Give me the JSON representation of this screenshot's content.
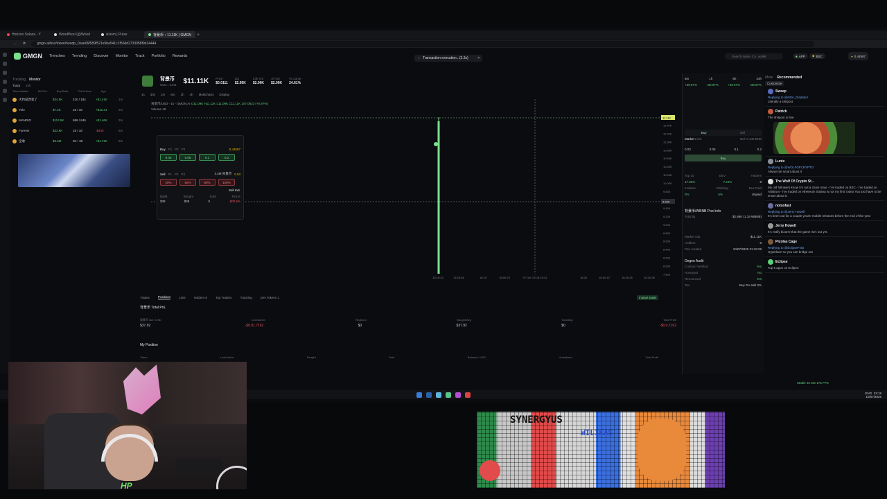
{
  "browser": {
    "tabs": [
      {
        "label": "Horizon Solana - Y"
      },
      {
        "label": "WoodPixel (@Wood"
      },
      {
        "label": "Axiom | Pulse"
      },
      {
        "label": "背景币 ↑ 11.11K | GMGN"
      }
    ],
    "url": "gmgn.ai/bsc/token/hoodp_0xae06f589f521e5ba541c1f55dd2733058f9d14444"
  },
  "nav": {
    "brand": "GMGN",
    "items": [
      "Trenches",
      "Trending",
      "Discover",
      "Monitor",
      "Track",
      "Portfolio",
      "Rewards"
    ],
    "toast": "Transaction execution...(3.3s)",
    "search_placeholder": "Search name, CA, wallet",
    "app_label": "APP",
    "chain": "BSC",
    "balance": "0.44597"
  },
  "monitor": {
    "title": "Monitor",
    "tab": "Track",
    "period": "24h",
    "columns": [
      "Token/Wallet",
      "MC/Vol",
      "Buy/Sells",
      "PNL/Inflow",
      "Age"
    ],
    "rows": [
      {
        "name": "大约就改变了",
        "mc": "$34.8K",
        "buys": "310 / 184",
        "pnl": "+$1.41K",
        "age": "1m"
      },
      {
        "name": "Yolo",
        "mc": "$7.2K",
        "buys": "18 / 18",
        "pnl": "+$42.41",
        "age": "2m"
      },
      {
        "name": "MANDIO",
        "mc": "$113.5K",
        "buys": "686 / 649",
        "pnl": "+$1.46K",
        "age": "3m"
      },
      {
        "name": "Forever",
        "mc": "$33.8K",
        "buys": "18 / 18",
        "pnl": "-$430",
        "age": "5m"
      },
      {
        "name": "全收",
        "mc": "$3.6M",
        "buys": "3K / 3K",
        "pnl": "+$1.72K",
        "age": "8m"
      }
    ]
  },
  "token": {
    "name": "背景币",
    "address": "0xae...4444",
    "price": "$11.11K",
    "stats": [
      {
        "label": "Price",
        "value": "$0.0111"
      },
      {
        "label": "Liq",
        "value": "$2.95K"
      },
      {
        "label": "24h Vol",
        "value": "$2.09K"
      },
      {
        "label": "1h Vol",
        "value": "$2.09K"
      },
      {
        "label": "% Curve",
        "value": "24.61%"
      }
    ],
    "chart_title": "背景币/USD - 1s - GMGN.AI",
    "ohlc": "O11.09K H11.11K L11.09K C11.11K 107.0623 (+0.97%)",
    "volume_label": "Volume",
    "volume_value": "18"
  },
  "chart_data": {
    "type": "candlestick",
    "x_ticks": [
      "15:15:23",
      "15:15:46",
      "15:19",
      "16:00:23",
      "07 Oct '25  16:15:31",
      "16:20",
      "16:20:13",
      "16:20:26",
      "16:20:39"
    ],
    "y_ticks": [
      "11.60K",
      "11.40K",
      "11.20K",
      "11.00K",
      "10.80K",
      "10.60K",
      "10.40K",
      "10.20K",
      "10.00K",
      "9.80K",
      "9.60K",
      "9.40K",
      "9.20K",
      "9.00K",
      "8.80K",
      "8.60K",
      "8.40K",
      "8.20K",
      "8.00K",
      "7.80K"
    ],
    "last_price": "11.11K",
    "crosshair_price": "9.23K",
    "ylim": [
      7700,
      11700
    ]
  },
  "quick": {
    "buy_label": "Buy",
    "sell_label": "Sell",
    "presets": [
      "P1",
      "P2",
      "P3"
    ],
    "balance": "0.44597",
    "buy_amounts": [
      "0.03",
      "0.05",
      "0.1",
      "0.2"
    ],
    "sell_amounts": [
      "20%",
      "50%",
      "80%",
      "100%"
    ],
    "sell_holding": "3.4M 背景币",
    "sell_value": "0.03",
    "sell_init": "Sell Initi.",
    "foot_labels": [
      "Bal/$",
      "Bought",
      "Sold",
      "PnL%"
    ],
    "foot_values": [
      "$38",
      "$38",
      "0",
      "-$00.6%"
    ]
  },
  "bottom": {
    "tabs": [
      "Trades",
      "Positions",
      "Limit",
      "Holders 8",
      "Top Traders",
      "Tracking",
      "Dev Tokens 1"
    ],
    "active_tab": "Positions",
    "instant_trade": "Instant trade",
    "pnl_title": "背景币 Total PnL",
    "columns": [
      "背景币 Bal / USD",
      "Unrealized",
      "Realized",
      "Bought/Avg",
      "Sold/Avg",
      "Total Profit"
    ],
    "values": [
      "$37.92",
      "-$0.01.7162",
      "$0",
      "$37.92",
      "$0",
      "-$0.0,7162"
    ],
    "my_position": "My Position",
    "pos_columns": [
      "Token",
      "Last Active",
      "Bought",
      "Sold",
      "Balance / USD",
      "Unrealized",
      "Total Profit"
    ]
  },
  "trade": {
    "tabs": [
      "5m",
      "1h",
      "6h",
      "24h"
    ],
    "changes": [
      "+39.97%",
      "+39.97%",
      "+39.97%",
      "+39.97%"
    ],
    "buy_label": "Buy",
    "sell_label": "Sell",
    "market_label": "Market",
    "limit_label": "Limit",
    "bal_label": "Bal: 0.446 BNB",
    "amounts": [
      "0.03",
      "0.05",
      "0.1",
      "0.2"
    ],
    "stats": [
      {
        "label": "Top 10",
        "value": "17.36%"
      },
      {
        "label": "DEV",
        "value": "7.24%"
      },
      {
        "label": "Holders",
        "value": "8"
      },
      {
        "label": "Insiders",
        "value": "0%"
      },
      {
        "label": "Phishing",
        "value": "6%"
      },
      {
        "label": "Dex Paid",
        "value": "Unpaid"
      }
    ],
    "pool_title": "背景币/WBNB Pool info",
    "pool_rows": [
      {
        "label": "Total liq",
        "value": "$2.95K (1.19 WBNB)"
      },
      {
        "label": "Market cap",
        "value": "$11.11K"
      },
      {
        "label": "Holders",
        "value": "8"
      },
      {
        "label": "Pair created",
        "value": "10/07/2025 21:18:29"
      }
    ],
    "audit_title": "Degen Audit",
    "audit_rows": [
      {
        "label": "Contract Verified",
        "value": "Yes"
      },
      {
        "label": "Honeypot",
        "value": "No"
      },
      {
        "label": "Renounced",
        "value": "Yes"
      },
      {
        "label": "Tax",
        "value": "Buy 0% Sell 0%"
      }
    ]
  },
  "feed": {
    "title": "Recommended",
    "customize": "Customize",
    "posts": [
      {
        "name": "Sweep",
        "reply": "Replying to @KEK_Gladiator",
        "text": "Literally a shitpost"
      },
      {
        "name": "Patrick",
        "reply": "",
        "text": "The shitpost is fine"
      },
      {
        "name": "Lunix",
        "reply": "Replying to @WOLFOFCRYPTO",
        "text": "Always be smart about it"
      },
      {
        "name": "The Wolf Of Crypto St...",
        "reply": "",
        "text": "My old followers know I'm not a chain maxi - I've traded on BSC - I've traded on Arbitrum - I've traded on ethereum Solana is not my first rodeo You just have to be smart about it."
      },
      {
        "name": "notsofast",
        "reply": "Replying to @Jerry Howell",
        "text": "It's been out for a couple years! mobile releases before the end of the year"
      },
      {
        "name": "Jerry Howell",
        "reply": "",
        "text": "It's really bizarre that the game isn't out yet."
      },
      {
        "name": "Picolas Cage",
        "reply": "Replying to @EclipseFND",
        "text": "Hyperlane so you can bridge out"
      },
      {
        "name": "Eclipse",
        "reply": "",
        "text": "Top 5 apps on Eclipse:"
      }
    ],
    "status": "Stable  32 MS  175 FPS"
  },
  "taskbar": {
    "time": "23:18",
    "date": "10/07/2025",
    "lang": "ENG"
  },
  "pixelart": {
    "text_lines": [
      "SYNERGYUS",
      "WILIKAS"
    ]
  },
  "cam": {
    "brand": "HP"
  },
  "colors": {
    "accent": "#59d07a",
    "negative": "#e0525a",
    "link": "#6ea4f0"
  }
}
